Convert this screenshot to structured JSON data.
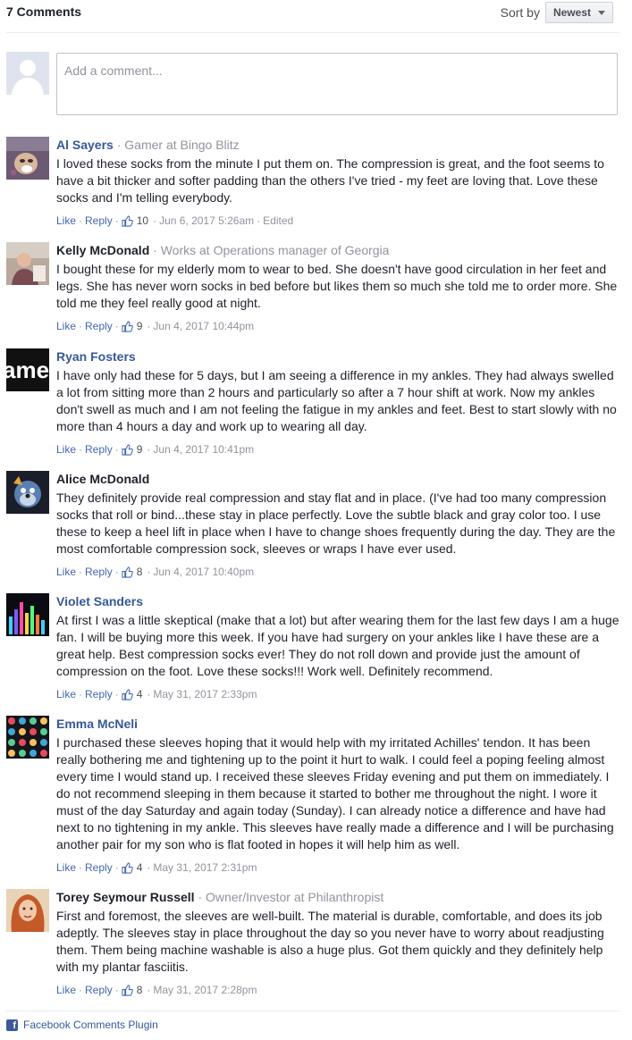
{
  "header": {
    "comment_count": "7 Comments",
    "sort_label": "Sort by",
    "sort_value": "Newest"
  },
  "composer": {
    "placeholder": "Add a comment..."
  },
  "comments": [
    {
      "name": "Al Sayers",
      "role": "Gamer at Bingo Blitz",
      "text": "I loved these socks from the minute I put them on. The compression is great, and the foot seems to have a bit thicker and softer padding than the others I've tried - my feet are loving that. Love these socks and I'm telling everybody.",
      "like": "Like",
      "reply": "Reply",
      "likes": "10",
      "date": "Jun 6, 2017 5:26am",
      "edited": "Edited",
      "avatar": "toad-avatar"
    },
    {
      "name": "Kelly McDonald",
      "role": "Works at Operations manager of Georgia",
      "text": "I bought these for my elderly mom to wear to bed. She doesn't have good circulation in her feet and legs. She has never worn socks in bed before but likes them so much she told me to order more. She told me they feel really good at night.",
      "like": "Like",
      "reply": "Reply",
      "likes": "9",
      "date": "Jun 4, 2017 10:44pm",
      "avatar": "photo-avatar"
    },
    {
      "name": "Ryan Fosters",
      "role": "",
      "text": "I have only had these for 5 days, but I am seeing a difference in my ankles. They had always swelled a lot from sitting more than 2 hours and particularly so after a 7 hour shift at work. Now my ankles don't swell as much and I am not feeling the fatigue in my ankles and feet. Best to start slowly with no more than 4 hours a day and work up to wearing all day.",
      "like": "Like",
      "reply": "Reply",
      "likes": "9",
      "date": "Jun 4, 2017 10:41pm",
      "avatar": "game-avatar",
      "avatar_text": "ame"
    },
    {
      "name": "Alice McDonald",
      "role": "",
      "text": "They definitely provide real compression and stay flat and in place. (I've had too many compression socks that roll or bind...these stay in place perfectly. Love the subtle black and gray color too. I use these to keep a heel lift in place when I have to change shoes frequently during the day. They are the most comfortable compression sock, sleeves or wraps I have ever used.",
      "like": "Like",
      "reply": "Reply",
      "likes": "8",
      "date": "Jun 4, 2017 10:40pm",
      "avatar": "cartoon-avatar"
    },
    {
      "name": "Violet Sanders",
      "role": "",
      "text": "At first I was a little skeptical (make that a lot) but after wearing them for the last few days I am a huge fan. I will be buying more this week. If you have had surgery on your ankles like I have these are a great help. Best compression socks ever! They do not roll down and provide just the amount of compression on the foot. Love these socks!!! Work well. Definitely recommend.",
      "like": "Like",
      "reply": "Reply",
      "likes": "4",
      "date": "May 31, 2017 2:33pm",
      "avatar": "equalizer-avatar"
    },
    {
      "name": "Emma McNeli",
      "role": "",
      "text": "I purchased these sleeves hoping that it would help with my irritated Achilles' tendon. It has been really bothering me and tightening up to the point it hurt to walk. I could feel a poping feeling almost every time I would stand up. I received these sleeves Friday evening and put them on immediately. I do not recommend sleeping in them because it started to bother me throughout the night. I wore it must of the day Saturday and again today (Sunday). I can already notice a difference and have had next to no tightening in my ankle. This sleeves have really made a difference and I will be purchasing another pair for my son who is flat footed in hopes it will help him as well.",
      "like": "Like",
      "reply": "Reply",
      "likes": "4",
      "date": "May 31, 2017 2:31pm",
      "avatar": "circles-avatar"
    },
    {
      "name": "Torey Seymour Russell",
      "role": "Owner/Investor at Philanthropist",
      "text": "First and foremost, the sleeves are well-built. The material is durable, comfortable, and does its job adeptly. The sleeves stay in place throughout the day so you never have to worry about readjusting them. Them being machine washable is also a huge plus. Got them quickly and they definitely help with my plantar fasciitis.",
      "like": "Like",
      "reply": "Reply",
      "likes": "8",
      "date": "May 31, 2017 2:28pm",
      "avatar": "portrait-avatar"
    }
  ],
  "footer": {
    "icon": "facebook-icon",
    "icon_glyph": "f",
    "label": "Facebook Comments Plugin"
  },
  "colors": {
    "name_link": "#365899",
    "action_link": "#4267b2",
    "meta": "#90949c"
  }
}
